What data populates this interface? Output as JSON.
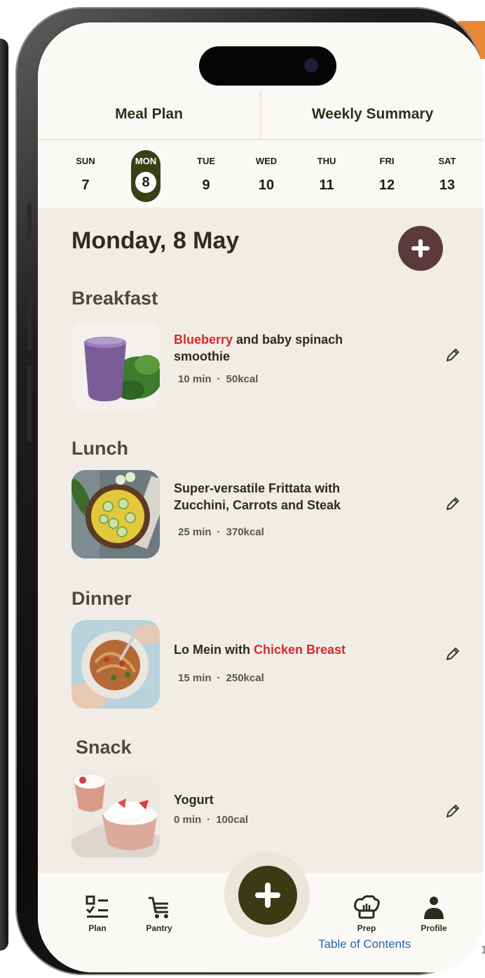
{
  "tabs": [
    {
      "label": "Meal Plan"
    },
    {
      "label": "Weekly Summary"
    }
  ],
  "days": [
    {
      "name": "SUN",
      "num": "7"
    },
    {
      "name": "MON",
      "num": "8"
    },
    {
      "name": "TUE",
      "num": "9"
    },
    {
      "name": "WED",
      "num": "10"
    },
    {
      "name": "THU",
      "num": "11"
    },
    {
      "name": "FRI",
      "num": "12"
    },
    {
      "name": "SAT",
      "num": "13"
    }
  ],
  "selected_day": "MON",
  "date_heading": "Monday, 8 May",
  "meals": {
    "breakfast": {
      "section": "Breakfast",
      "name_highlight": "Blueberry",
      "name_rest": " and baby spinach smoothie",
      "time": "10 min",
      "kcal": "50kcal"
    },
    "lunch": {
      "section": "Lunch",
      "name": "Super-versatile Frittata with Zucchini, Carrots and Steak",
      "time": "25 min",
      "kcal": "370kcal"
    },
    "dinner": {
      "section": "Dinner",
      "name_start": "Lo Mein with ",
      "name_highlight": "Chicken Breast",
      "time": "15 min",
      "kcal": "250kcal"
    },
    "snack": {
      "section": "Snack",
      "name": "Yogurt",
      "time": "0 min",
      "kcal": "100cal"
    }
  },
  "meta_separator": "·",
  "nav": {
    "plan": "Plan",
    "pantry": "Pantry",
    "prep": "Prep",
    "profile": "Profile"
  },
  "overlay": {
    "toc_link": "Table of Contents",
    "page_number": "1"
  },
  "colors": {
    "accent_dark": "#3a3f17",
    "add_button": "#5b3a3d",
    "highlight": "#d22b2b",
    "background": "#f1ece6"
  }
}
